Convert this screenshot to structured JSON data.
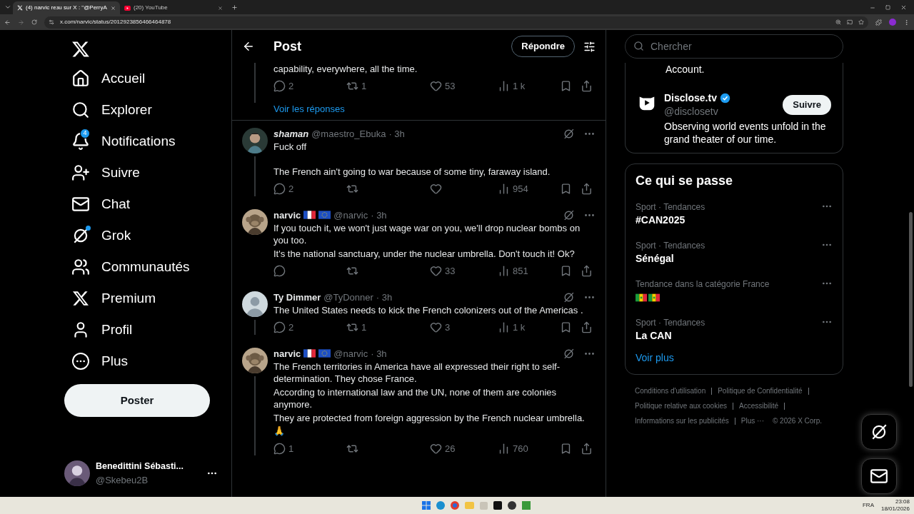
{
  "browser": {
    "tabs": [
      {
        "title": "(4) narvic reзu sur X : \"@PerryA",
        "kind": "x",
        "selected": true
      },
      {
        "title": "(20) YouTube",
        "kind": "youtube",
        "selected": false
      }
    ],
    "url": "x.com/narvic/status/2012923856466464878"
  },
  "nav": {
    "items": [
      {
        "label": "Accueil"
      },
      {
        "label": "Explorer"
      },
      {
        "label": "Notifications",
        "badge": "4"
      },
      {
        "label": "Suivre"
      },
      {
        "label": "Chat"
      },
      {
        "label": "Grok",
        "dot": true
      },
      {
        "label": "Communautés"
      },
      {
        "label": "Premium"
      },
      {
        "label": "Profil"
      },
      {
        "label": "Plus"
      }
    ],
    "post_button": "Poster",
    "account": {
      "name": "Benedittini Sébasti...",
      "handle": "@Skebeu2B"
    }
  },
  "header": {
    "title": "Post",
    "reply_button": "Répondre"
  },
  "thread_top": {
    "text": "capability, everywhere, all the time.",
    "stats": {
      "replies": "2",
      "reposts": "1",
      "likes": "53",
      "views": "1 k"
    },
    "show_replies": "Voir les réponses"
  },
  "replies": [
    {
      "name": "shaman",
      "italic": true,
      "handle": "@maestro_Ebuka",
      "time": "· 3h",
      "text": [
        "Fuck off",
        "The French ain't going to war because of some tiny, faraway island."
      ],
      "thread": true,
      "stats": {
        "replies": "2",
        "views": "954"
      }
    },
    {
      "name": "narvic",
      "italic": false,
      "badges": [
        {
          "kind": "france"
        },
        {
          "kind": "eu"
        }
      ],
      "handle": "@narvic",
      "time": "· 3h",
      "text": [
        "If you touch it, we won't just wage war on you, we'll drop nuclear bombs on you too.",
        "It's the national sanctuary, under the nuclear umbrella. Don't touch it! Ok?"
      ],
      "thread": false,
      "stats": {
        "likes": "33",
        "views": "851"
      }
    },
    {
      "name": "Ty Dimmer",
      "italic": false,
      "handle": "@TyDonner",
      "time": "· 3h",
      "text": [
        "The United States needs to kick the French colonizers out of the Americas ."
      ],
      "thread": true,
      "stats": {
        "replies": "2",
        "reposts": "1",
        "likes": "3",
        "views": "1 k"
      }
    },
    {
      "name": "narvic",
      "italic": false,
      "badges": [
        {
          "kind": "france"
        },
        {
          "kind": "eu"
        }
      ],
      "handle": "@narvic",
      "time": "· 3h",
      "text": [
        "The French territories in America have all expressed their right to self-determination. They chose France.",
        "According to international law and the UN, none of them are colonies anymore.",
        "They are protected from foreign aggression by the French nuclear umbrella.",
        "🙏"
      ],
      "thread": true,
      "stats": {
        "replies": "1",
        "likes": "26",
        "views": "760"
      }
    }
  ],
  "search": {
    "placeholder": "Chercher"
  },
  "who_to_follow": {
    "partial_text": "Account.",
    "account": {
      "name": "Disclose.tv",
      "verified": true,
      "handle": "@disclosetv",
      "bio": "Observing world events unfold in the grand theater of our time.",
      "button": "Suivre"
    }
  },
  "trends": {
    "title": "Ce qui se passe",
    "items": [
      {
        "context": "Sport · Tendances",
        "topic": "#CAN2025",
        "kind": "text"
      },
      {
        "context": "Sport · Tendances",
        "topic": "Sénégal",
        "kind": "text"
      },
      {
        "context": "Tendance dans la catégorie France",
        "kind": "flags"
      },
      {
        "context": "Sport · Tendances",
        "topic": "La CAN",
        "kind": "text"
      }
    ],
    "more": "Voir plus"
  },
  "footer": {
    "links": [
      "Conditions d'utilisation",
      "Politique de Confidentialité",
      "Politique relative aux cookies",
      "Accessibilité",
      "Informations sur les publicités",
      "Plus ···"
    ],
    "copyright": "© 2026 X Corp."
  },
  "taskbar": {
    "language": "FRA",
    "time": "23:08",
    "date": "18/01/2026"
  }
}
